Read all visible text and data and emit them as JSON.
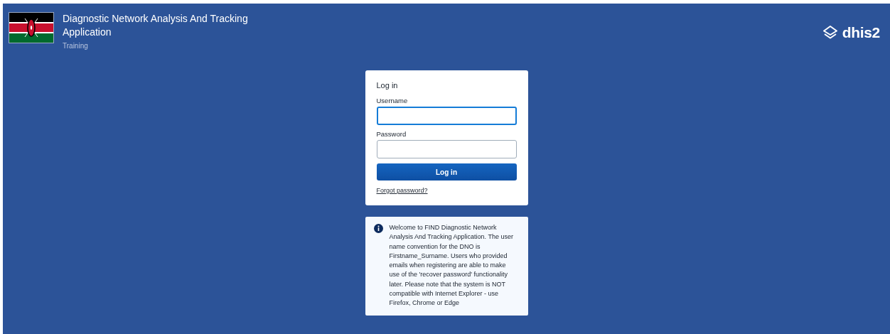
{
  "header": {
    "title": "Diagnostic Network Analysis And Tracking Application",
    "subtitle": "Training",
    "logo_text": "dhis2"
  },
  "login": {
    "title": "Log in",
    "fields": [
      {
        "label": "Username",
        "focused": true
      },
      {
        "label": "Password",
        "focused": false
      }
    ],
    "submit": "Log in",
    "forgot": "Forgot password?"
  },
  "notice": {
    "text": "Welcome to FIND Diagnostic Network Analysis And Tracking Application. The user name convention for the DNO is Firstname_Surname. Users who provided emails when registering are able to make use of the 'recover password' functionality later. Please note that the system is NOT compatible with Internet Explorer - use Firefox, Chrome or Edge"
  }
}
